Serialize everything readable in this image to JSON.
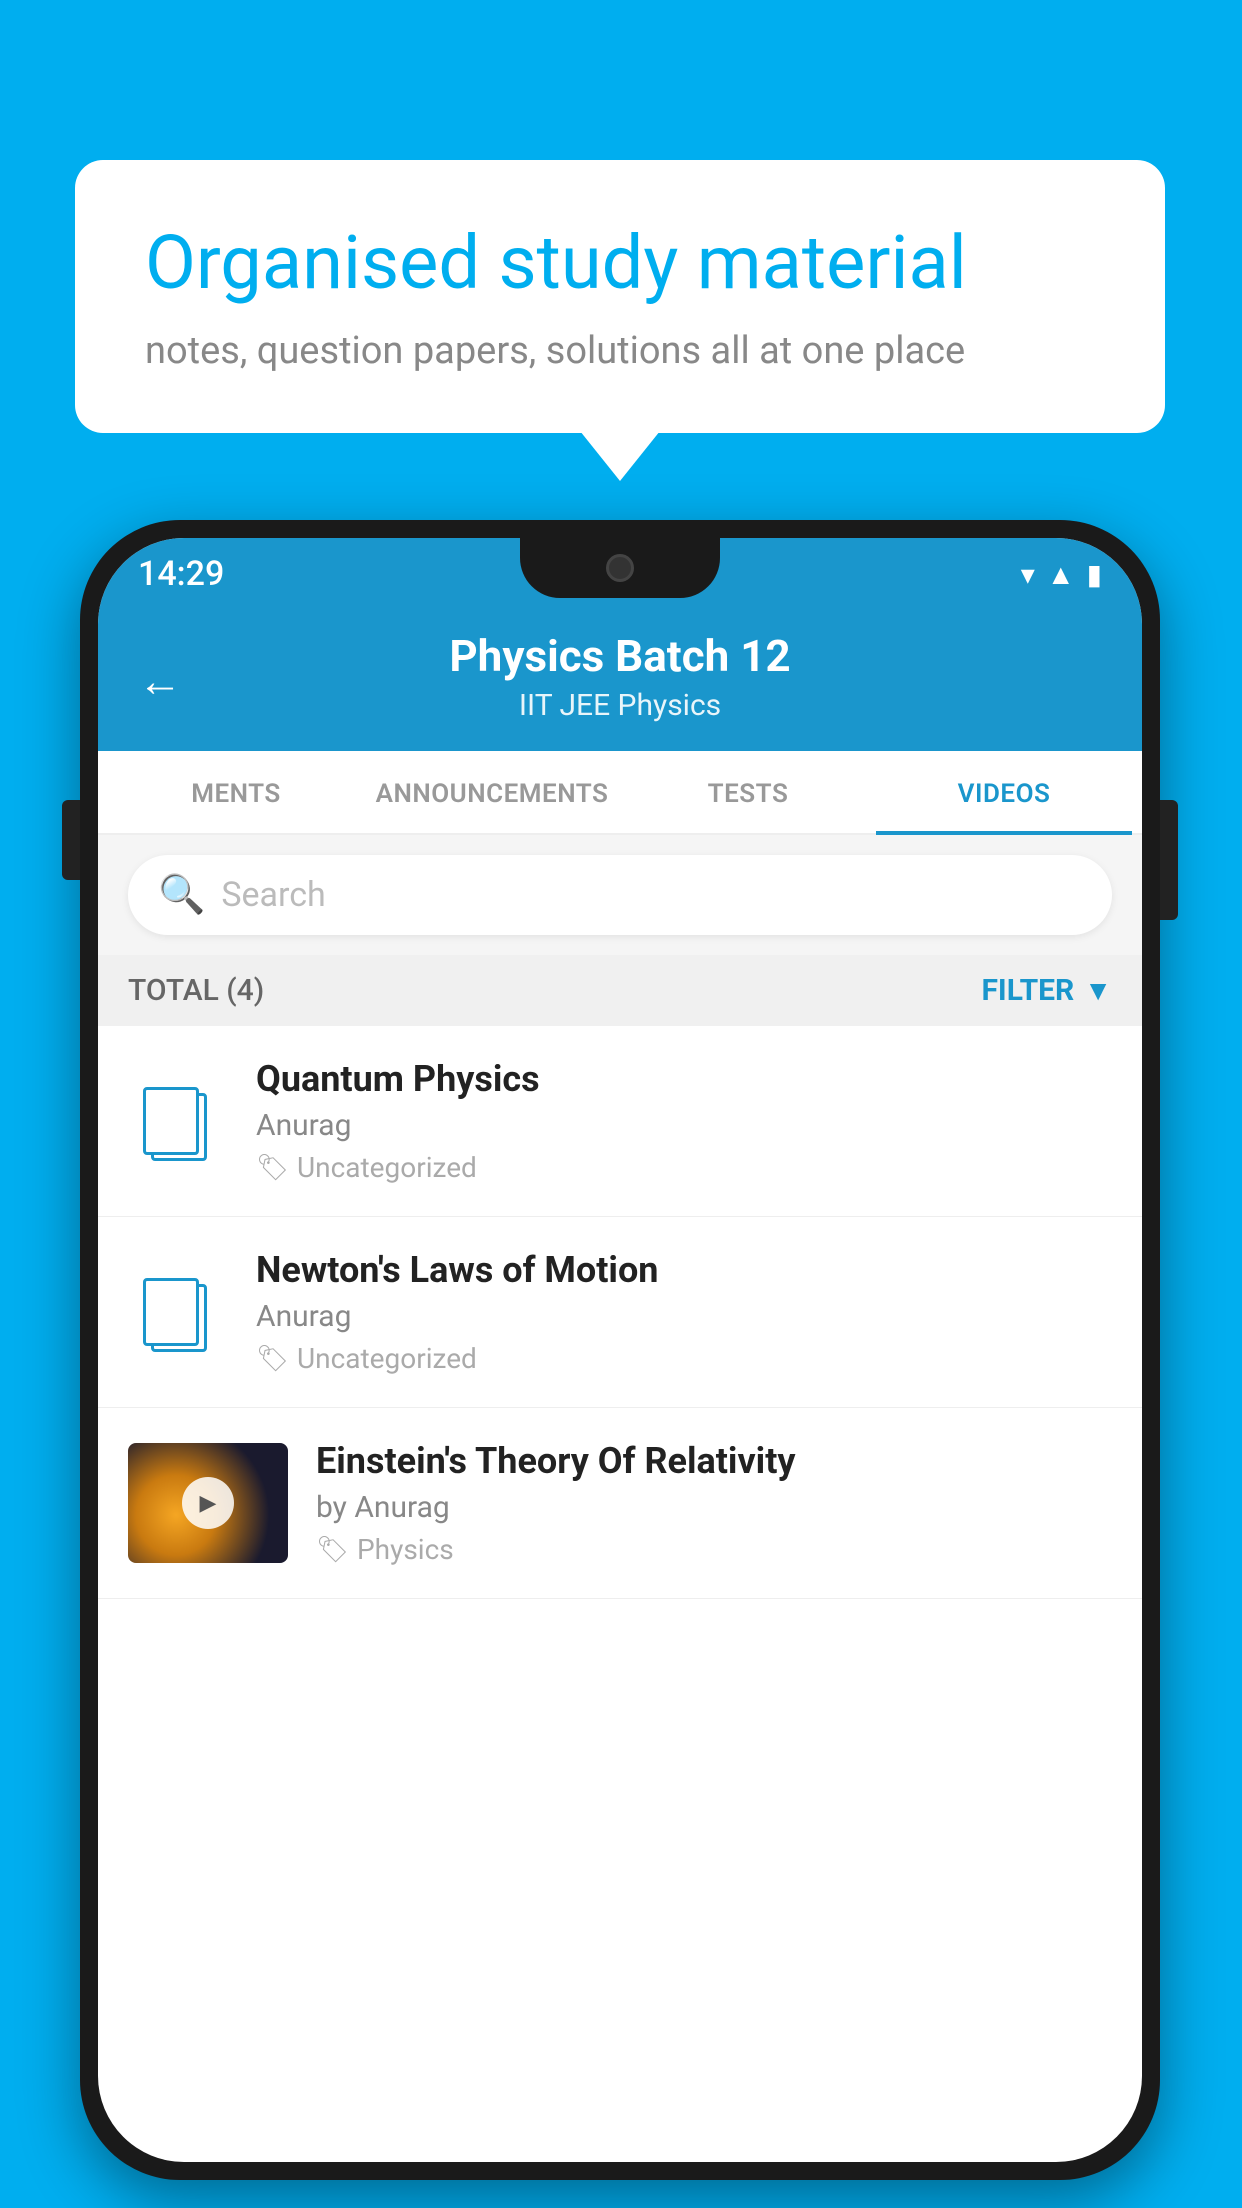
{
  "background": {
    "color": "#00AEEF"
  },
  "speech_bubble": {
    "title": "Organised study material",
    "subtitle": "notes, question papers, solutions all at one place"
  },
  "phone": {
    "status_bar": {
      "time": "14:29"
    },
    "header": {
      "title": "Physics Batch 12",
      "subtitle": "IIT JEE   Physics",
      "back_label": "←"
    },
    "tabs": [
      {
        "label": "MENTS",
        "active": false
      },
      {
        "label": "ANNOUNCEMENTS",
        "active": false
      },
      {
        "label": "TESTS",
        "active": false
      },
      {
        "label": "VIDEOS",
        "active": true
      }
    ],
    "search": {
      "placeholder": "Search"
    },
    "filter_bar": {
      "total_label": "TOTAL (4)",
      "filter_label": "FILTER"
    },
    "videos": [
      {
        "id": 1,
        "title": "Quantum Physics",
        "author": "Anurag",
        "tag": "Uncategorized",
        "has_thumbnail": false
      },
      {
        "id": 2,
        "title": "Newton's Laws of Motion",
        "author": "Anurag",
        "tag": "Uncategorized",
        "has_thumbnail": false
      },
      {
        "id": 3,
        "title": "Einstein's Theory Of Relativity",
        "author": "by Anurag",
        "tag": "Physics",
        "has_thumbnail": true
      }
    ]
  }
}
